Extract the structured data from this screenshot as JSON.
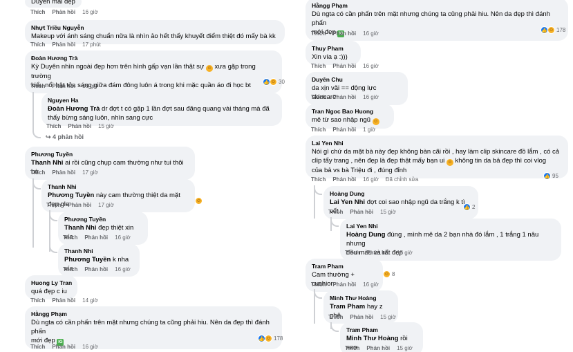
{
  "labels": {
    "like": "Thích",
    "reply": "Phản hồi",
    "edited": "Đã chỉnh sửa"
  },
  "left": {
    "c0": {
      "text": "Duyên mãi đẹp",
      "time": "16 giờ"
    },
    "c1": {
      "author": "Nhựt Triều Nguyễn",
      "text": "Makeup với ánh sáng chuẩn nữa là nhìn ảo hết thấy khuyết điểm thiệt đó mấy bà kk",
      "time": "17 phút"
    },
    "c2": {
      "author": "Đoàn Hương Trà",
      "text1": "Kỳ Duyên nhìn ngoài đẹp hơn trên hình gấp vạn lần thật sự",
      "text1b": "xưa gặp trong trường",
      "text2": "kiểu nổi bật tỏa sáng giữa đám đông luôn á trong khi mặc quần áo đi học bt",
      "time": "16 giờ",
      "reacts": "30"
    },
    "c3": {
      "author": "Nguyen Ha",
      "mention": "Đoàn Hương Trà",
      "text1": "dr đợt t có gặp 1 lần đợt sau đăng quang vài tháng mà đã",
      "text2": "thấy bừng sáng luôn, nhìn sang cực",
      "time": "15 giờ"
    },
    "more_replies": "4 phản hồi",
    "c4": {
      "author": "Phương Tuyền",
      "mention": "Thanh Nhi",
      "text": "ai rồi cũng chụp cam thường như tui thôi bà",
      "time": "17 giờ"
    },
    "c5": {
      "author": "Thanh Nhi",
      "mention": "Phương Tuyền",
      "text": "này cam thường thiệt da mặt đẹp gle",
      "time": "17 giờ"
    },
    "c6": {
      "author": "Phương Tuyền",
      "mention": "Thanh Nhi",
      "text": "đẹp thiệt xin vía",
      "time": "16 giờ"
    },
    "c7": {
      "author": "Thanh Nhi",
      "mention": "Phương Tuyền",
      "text": "k nha vía",
      "time": "16 giờ"
    },
    "c8": {
      "author": "Huong Ly Tran",
      "text": "quá đẹp c iu",
      "time": "14 giờ"
    },
    "c9": {
      "author": "Hằngg Phạm",
      "text1": "Dù ngta có cần phấn trên mặt nhưng chúng ta cũng phải hiu. Nên da đẹp thì đánh phấn",
      "text2": "mới đẹp",
      "time": "16 giờ",
      "reacts": "178"
    }
  },
  "right": {
    "c1": {
      "author": "Hằngg Phạm",
      "text1": "Dù ngta có cần phấn trên mặt nhưng chúng ta cũng phải hiu. Nên da đẹp thì đánh phấn",
      "text2": "mới đẹp",
      "time": "16 giờ",
      "reacts": "178"
    },
    "c2": {
      "author": "Thuy Pham",
      "text": "Xin vía ạ :)))",
      "time": "16 giờ"
    },
    "c3": {
      "author": "Duyên Chu",
      "text": "da xịn vãi == động lực skincare",
      "time": "16 giờ"
    },
    "c4": {
      "author": "Tran Ngoc Bao Huong",
      "text": "mê từ sao nhập ngũ",
      "time": "1 giờ"
    },
    "c5": {
      "author": "Lai Yen Nhi",
      "text1": "Nói gì chứ da mặt bà này đẹp không bàn cãi rồi , hay làm clip skincare đồ lắm , có cả",
      "text2": "clip tẩy trang , nên đẹp là đẹp thật mấy bạn ui",
      "text2b": "không tin da bả đẹp thì coi vlog",
      "text3": "của bả vs bà Triệu đi , đúng đỉnh",
      "time": "16 giờ",
      "reacts": "95"
    },
    "c6": {
      "author": "Hoàng Dung",
      "mention": "Lai Yen Nhi",
      "text": "đợt coi sao nhập ngũ da trắng k tì vết.",
      "time": "15 giờ",
      "reacts": "2"
    },
    "c7": {
      "author": "Lai Yen Nhi",
      "mention": "Hoàng Dung",
      "text1": "đúng , mình mê da 2 bạn nhà đó lắm , 1 trắng 1 nâu nhưng",
      "text2": "đều màu và rất đẹp",
      "time": "15 giờ"
    },
    "c8": {
      "author": "Tram Pham",
      "text": "Cam thường + cushion",
      "time": "16 giờ",
      "reacts": "8"
    },
    "c9": {
      "author": "Minh Thư Hoàng",
      "mention": "Tram Pham",
      "text": "hay z ghê",
      "time": "15 giờ"
    },
    "c10": {
      "author": "Tram Pham",
      "mention": "Minh Thư Hoàng",
      "text": "rồi sao",
      "time": "15 giờ"
    }
  }
}
